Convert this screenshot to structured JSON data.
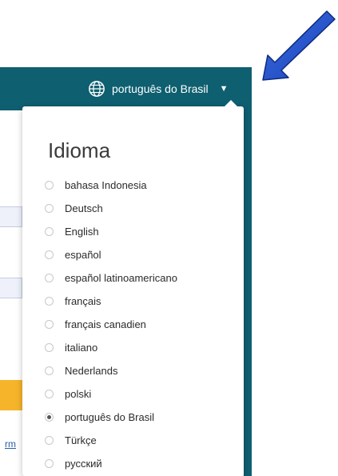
{
  "topbar": {
    "language_label": "português do Brasil",
    "caret": "▼",
    "color": "#0e5f70"
  },
  "dropdown": {
    "title": "Idioma",
    "languages": [
      {
        "label": "bahasa Indonesia",
        "selected": false
      },
      {
        "label": "Deutsch",
        "selected": false
      },
      {
        "label": "English",
        "selected": false
      },
      {
        "label": "español",
        "selected": false
      },
      {
        "label": "español latinoamericano",
        "selected": false
      },
      {
        "label": "français",
        "selected": false
      },
      {
        "label": "français canadien",
        "selected": false
      },
      {
        "label": "italiano",
        "selected": false
      },
      {
        "label": "Nederlands",
        "selected": false
      },
      {
        "label": "polski",
        "selected": false
      },
      {
        "label": "português do Brasil",
        "selected": true
      },
      {
        "label": "Türkçe",
        "selected": false
      },
      {
        "label": "русский",
        "selected": false
      }
    ]
  },
  "background": {
    "edge_link_text": "rm",
    "button_color": "#f5b42a"
  },
  "annotation": {
    "arrow_color": "#1a3fb8"
  }
}
